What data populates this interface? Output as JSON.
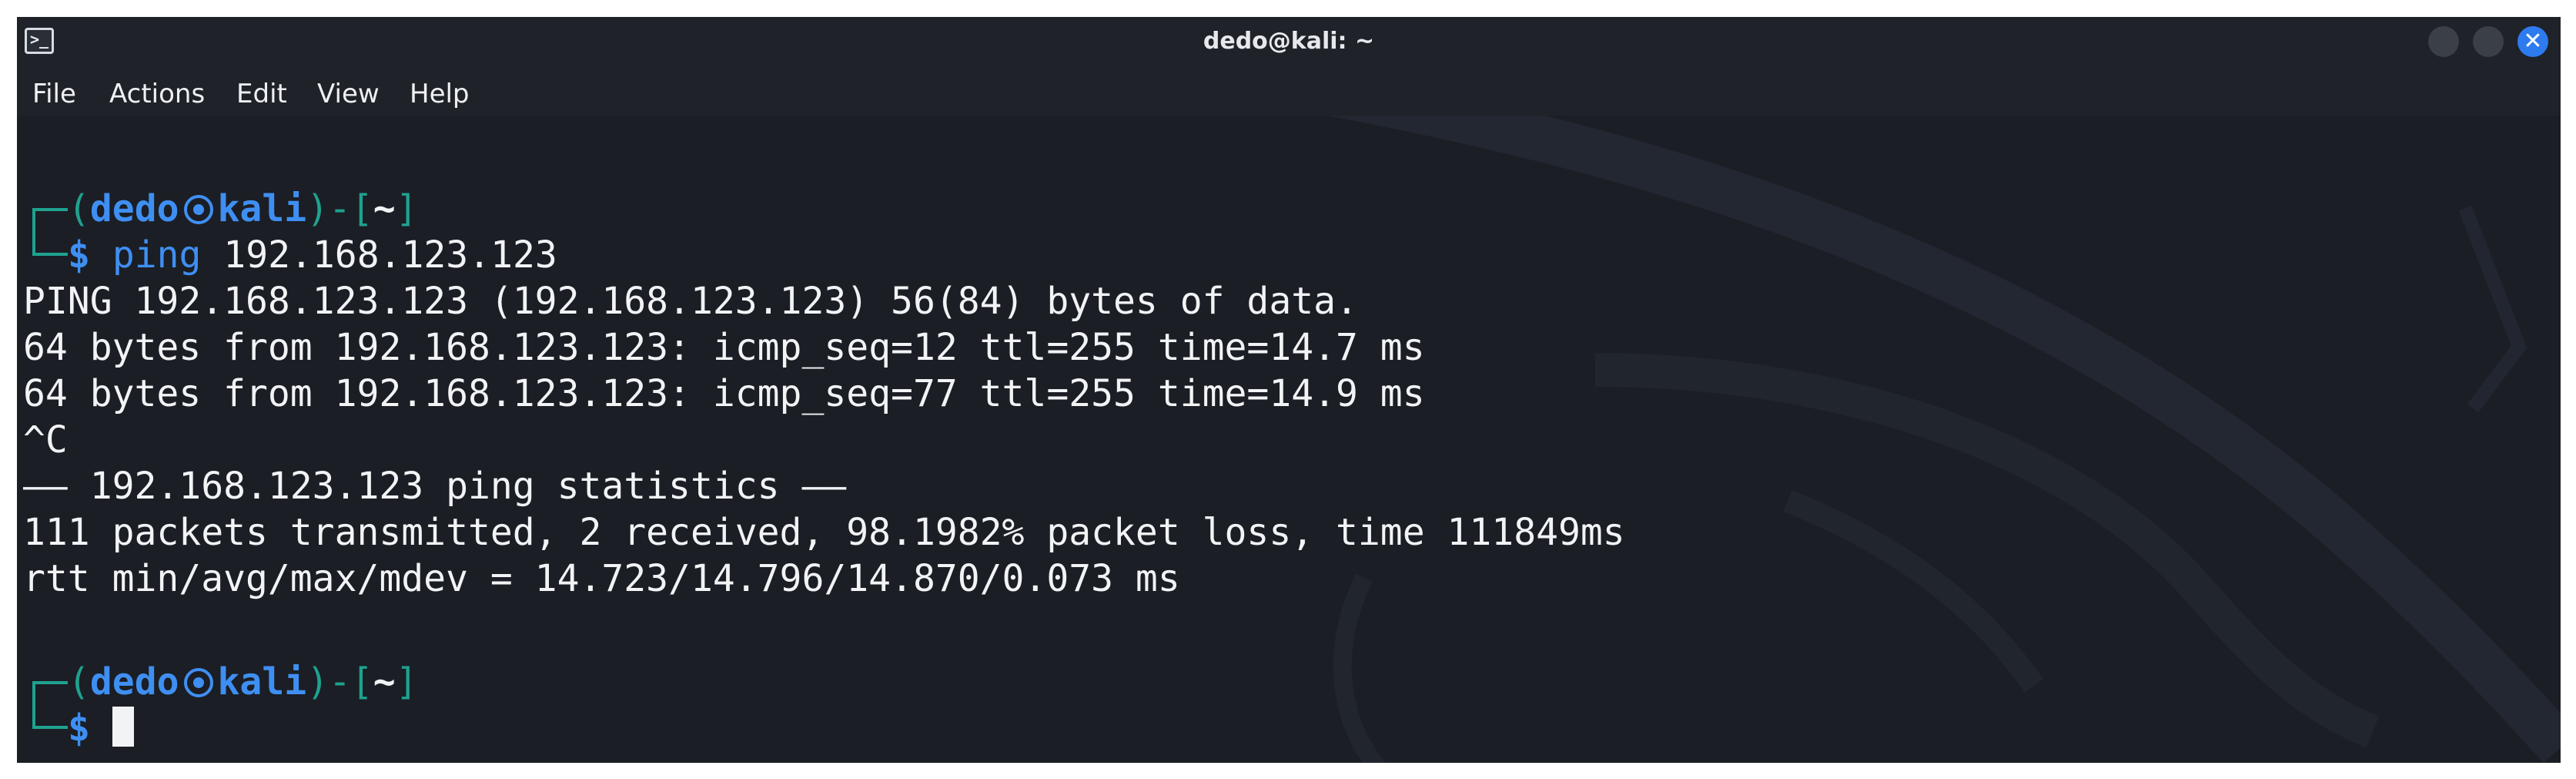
{
  "window": {
    "title": "dedo@kali: ~",
    "app_icon": "terminal-icon",
    "buttons": [
      "minimize-icon",
      "maximize-icon",
      "close-icon"
    ]
  },
  "menubar": {
    "items": [
      "File",
      "Actions",
      "Edit",
      "View",
      "Help"
    ]
  },
  "terminal": {
    "prompt1": {
      "open": "(",
      "user": "dedo",
      "host": "kali",
      "close": ")-[",
      "path": "~",
      "end": "]",
      "dollar": "$",
      "command": "ping",
      "args": " 192.168.123.123"
    },
    "output": [
      "PING 192.168.123.123 (192.168.123.123) 56(84) bytes of data.",
      "64 bytes from 192.168.123.123: icmp_seq=12 ttl=255 time=14.7 ms",
      "64 bytes from 192.168.123.123: icmp_seq=77 ttl=255 time=14.9 ms",
      "^C",
      "—— 192.168.123.123 ping statistics ——",
      "111 packets transmitted, 2 received, 98.1982% packet loss, time 111849ms",
      "rtt min/avg/max/mdev = 14.723/14.796/14.870/0.073 ms"
    ],
    "prompt2": {
      "open": "(",
      "user": "dedo",
      "host": "kali",
      "close": ")-[",
      "path": "~",
      "end": "]",
      "dollar": "$"
    },
    "colors": {
      "background": "#1b1e25",
      "prompt_frame": "#1ea28f",
      "prompt_user": "#3f8ff2",
      "text": "#f1f3f5"
    }
  }
}
